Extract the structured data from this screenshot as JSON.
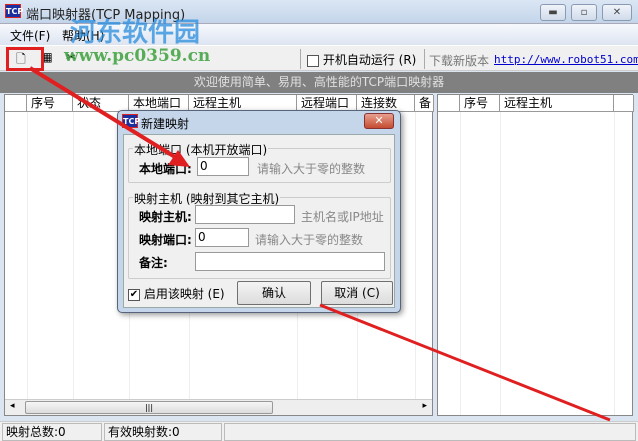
{
  "window": {
    "title": "端口映射器(TCP Mapping)",
    "icon_text": "TCP"
  },
  "menu": [
    "文件(F)",
    "帮助(H)"
  ],
  "toolbar": {
    "autostart_label": "开机自动运行 (R)",
    "download_label": "下载新版本",
    "download_link": "http://www.robot51.com"
  },
  "banner": "欢迎使用简单、易用、高性能的TCP端口映射器",
  "left_list": {
    "columns": [
      "",
      "序号",
      "状态",
      "本地端口",
      "远程主机",
      "远程端口",
      "连接数",
      "备注"
    ]
  },
  "right_list": {
    "columns": [
      "",
      "序号",
      "远程主机",
      ""
    ]
  },
  "status": {
    "total": "映射总数:0",
    "valid": "有效映射数:0"
  },
  "dialog": {
    "title": "新建映射",
    "local_group": "本地端口 (本机开放端口)",
    "local_port_label": "本地端口:",
    "local_port_value": "0",
    "local_hint": "请输入大于零的整数",
    "host_group": "映射主机 (映射到其它主机)",
    "host_label": "映射主机:",
    "host_value": "",
    "host_hint": "主机名或IP地址",
    "map_port_label": "映射端口:",
    "map_port_value": "0",
    "map_port_hint": "请输入大于零的整数",
    "note_label": "备注:",
    "note_value": "",
    "enable_label": "启用该映射 (E)",
    "enable_checked": true,
    "ok": "确认",
    "cancel": "取消 (C)"
  },
  "watermark": {
    "site": "河东软件园",
    "url": "www.pc0359.cn"
  },
  "colors": {
    "banner": "#808080",
    "link": "#0000cc",
    "annotation": "#e02020"
  }
}
